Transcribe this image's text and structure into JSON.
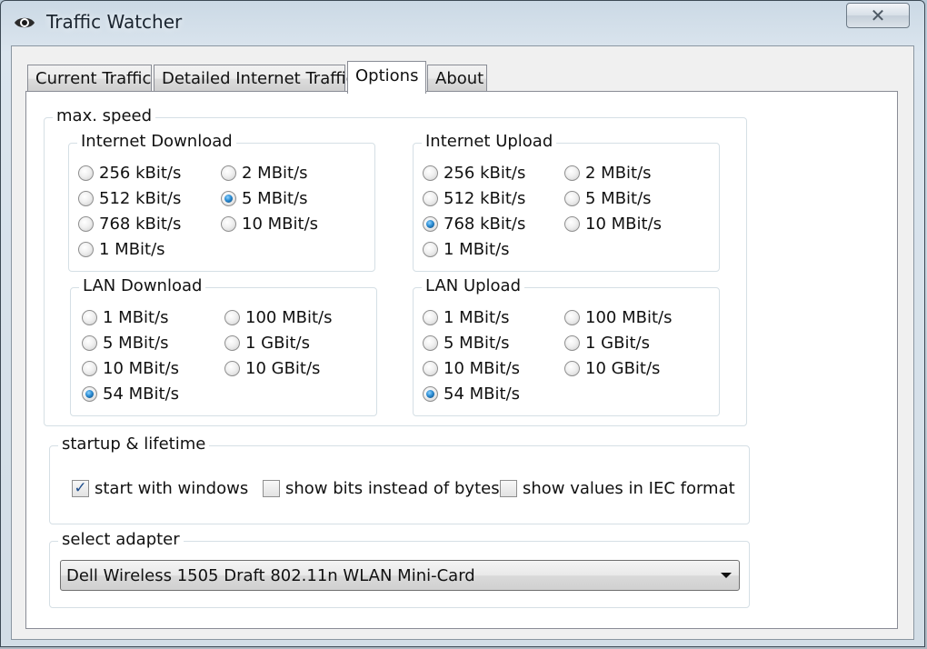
{
  "window": {
    "title": "Traffic Watcher",
    "close_label": "✕"
  },
  "tabs": [
    {
      "label": "Current Traffic"
    },
    {
      "label": "Detailed Internet Traffic"
    },
    {
      "label": "Options",
      "active": true
    },
    {
      "label": "About"
    }
  ],
  "max_speed": {
    "label": "max. speed",
    "internet_download": {
      "label": "Internet Download",
      "options": [
        "256 kBit/s",
        "512 kBit/s",
        "768 kBit/s",
        "1 MBit/s",
        "2 MBit/s",
        "5 MBit/s",
        "10 MBit/s"
      ],
      "selected": "5 MBit/s"
    },
    "internet_upload": {
      "label": "Internet Upload",
      "options": [
        "256 kBit/s",
        "512 kBit/s",
        "768 kBit/s",
        "1 MBit/s",
        "2 MBit/s",
        "5 MBit/s",
        "10 MBit/s"
      ],
      "selected": "768 kBit/s"
    },
    "lan_download": {
      "label": "LAN Download",
      "options": [
        "1 MBit/s",
        "5 MBit/s",
        "10 MBit/s",
        "54 MBit/s",
        "100 MBit/s",
        "1 GBit/s",
        "10 GBit/s"
      ],
      "selected": "54 MBit/s"
    },
    "lan_upload": {
      "label": "LAN Upload",
      "options": [
        "1 MBit/s",
        "5 MBit/s",
        "10 MBit/s",
        "54 MBit/s",
        "100 MBit/s",
        "1 GBit/s",
        "10 GBit/s"
      ],
      "selected": "54 MBit/s"
    }
  },
  "startup": {
    "label": "startup & lifetime",
    "start_with_windows": {
      "label": "start with windows",
      "checked": true
    },
    "show_bits": {
      "label": "show bits instead of bytes",
      "checked": false
    },
    "show_iec": {
      "label": "show values in IEC format",
      "checked": false
    }
  },
  "adapter": {
    "label": "select adapter",
    "selected": "Dell Wireless 1505 Draft 802.11n WLAN Mini-Card"
  }
}
